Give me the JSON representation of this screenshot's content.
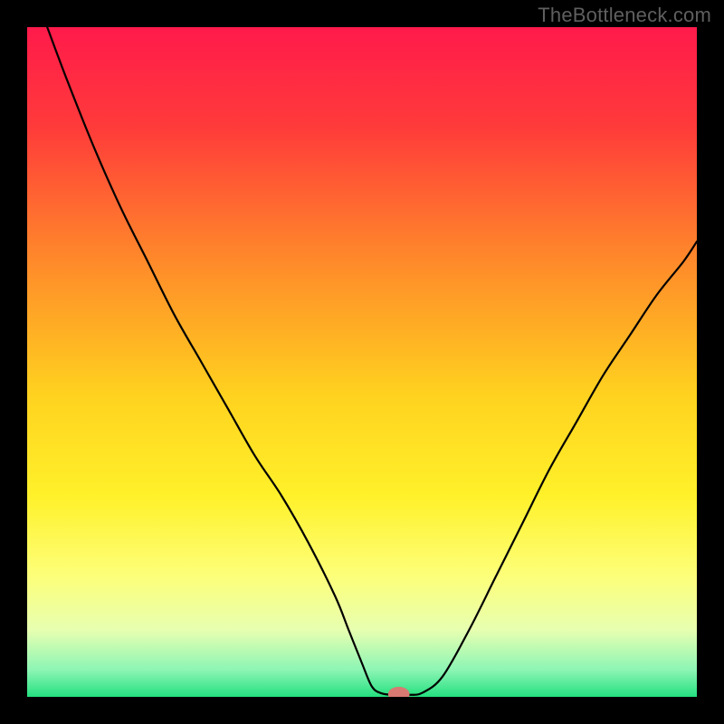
{
  "watermark": "TheBottleneck.com",
  "chart_data": {
    "type": "line",
    "title": "",
    "xlabel": "",
    "ylabel": "",
    "xlim": [
      0,
      100
    ],
    "ylim": [
      0,
      100
    ],
    "grid": false,
    "legend": false,
    "background_gradient": {
      "stops": [
        {
          "offset": 0.0,
          "color": "#ff1a4b"
        },
        {
          "offset": 0.15,
          "color": "#ff3b3a"
        },
        {
          "offset": 0.35,
          "color": "#ff8a2a"
        },
        {
          "offset": 0.55,
          "color": "#ffd21f"
        },
        {
          "offset": 0.7,
          "color": "#fff12a"
        },
        {
          "offset": 0.82,
          "color": "#fdff7a"
        },
        {
          "offset": 0.9,
          "color": "#e7ffb0"
        },
        {
          "offset": 0.96,
          "color": "#8cf5b5"
        },
        {
          "offset": 1.0,
          "color": "#24e07f"
        }
      ]
    },
    "series": [
      {
        "name": "bottleneck-curve",
        "stroke": "#000000",
        "x": [
          3,
          6,
          10,
          14,
          18,
          22,
          26,
          30,
          34,
          38,
          42,
          46,
          48,
          50,
          51.5,
          53,
          55,
          57,
          59,
          62,
          66,
          70,
          74,
          78,
          82,
          86,
          90,
          94,
          98,
          100
        ],
        "y": [
          100,
          92,
          82,
          73,
          65,
          57,
          50,
          43,
          36,
          30,
          23,
          15,
          10,
          5,
          1.5,
          0.5,
          0.3,
          0.3,
          0.6,
          3,
          10,
          18,
          26,
          34,
          41,
          48,
          54,
          60,
          65,
          68
        ]
      }
    ],
    "marker": {
      "name": "optimal-point",
      "x": 55.5,
      "y": 0.4,
      "rx": 1.6,
      "ry": 1.1,
      "fill": "#d87a72"
    }
  }
}
